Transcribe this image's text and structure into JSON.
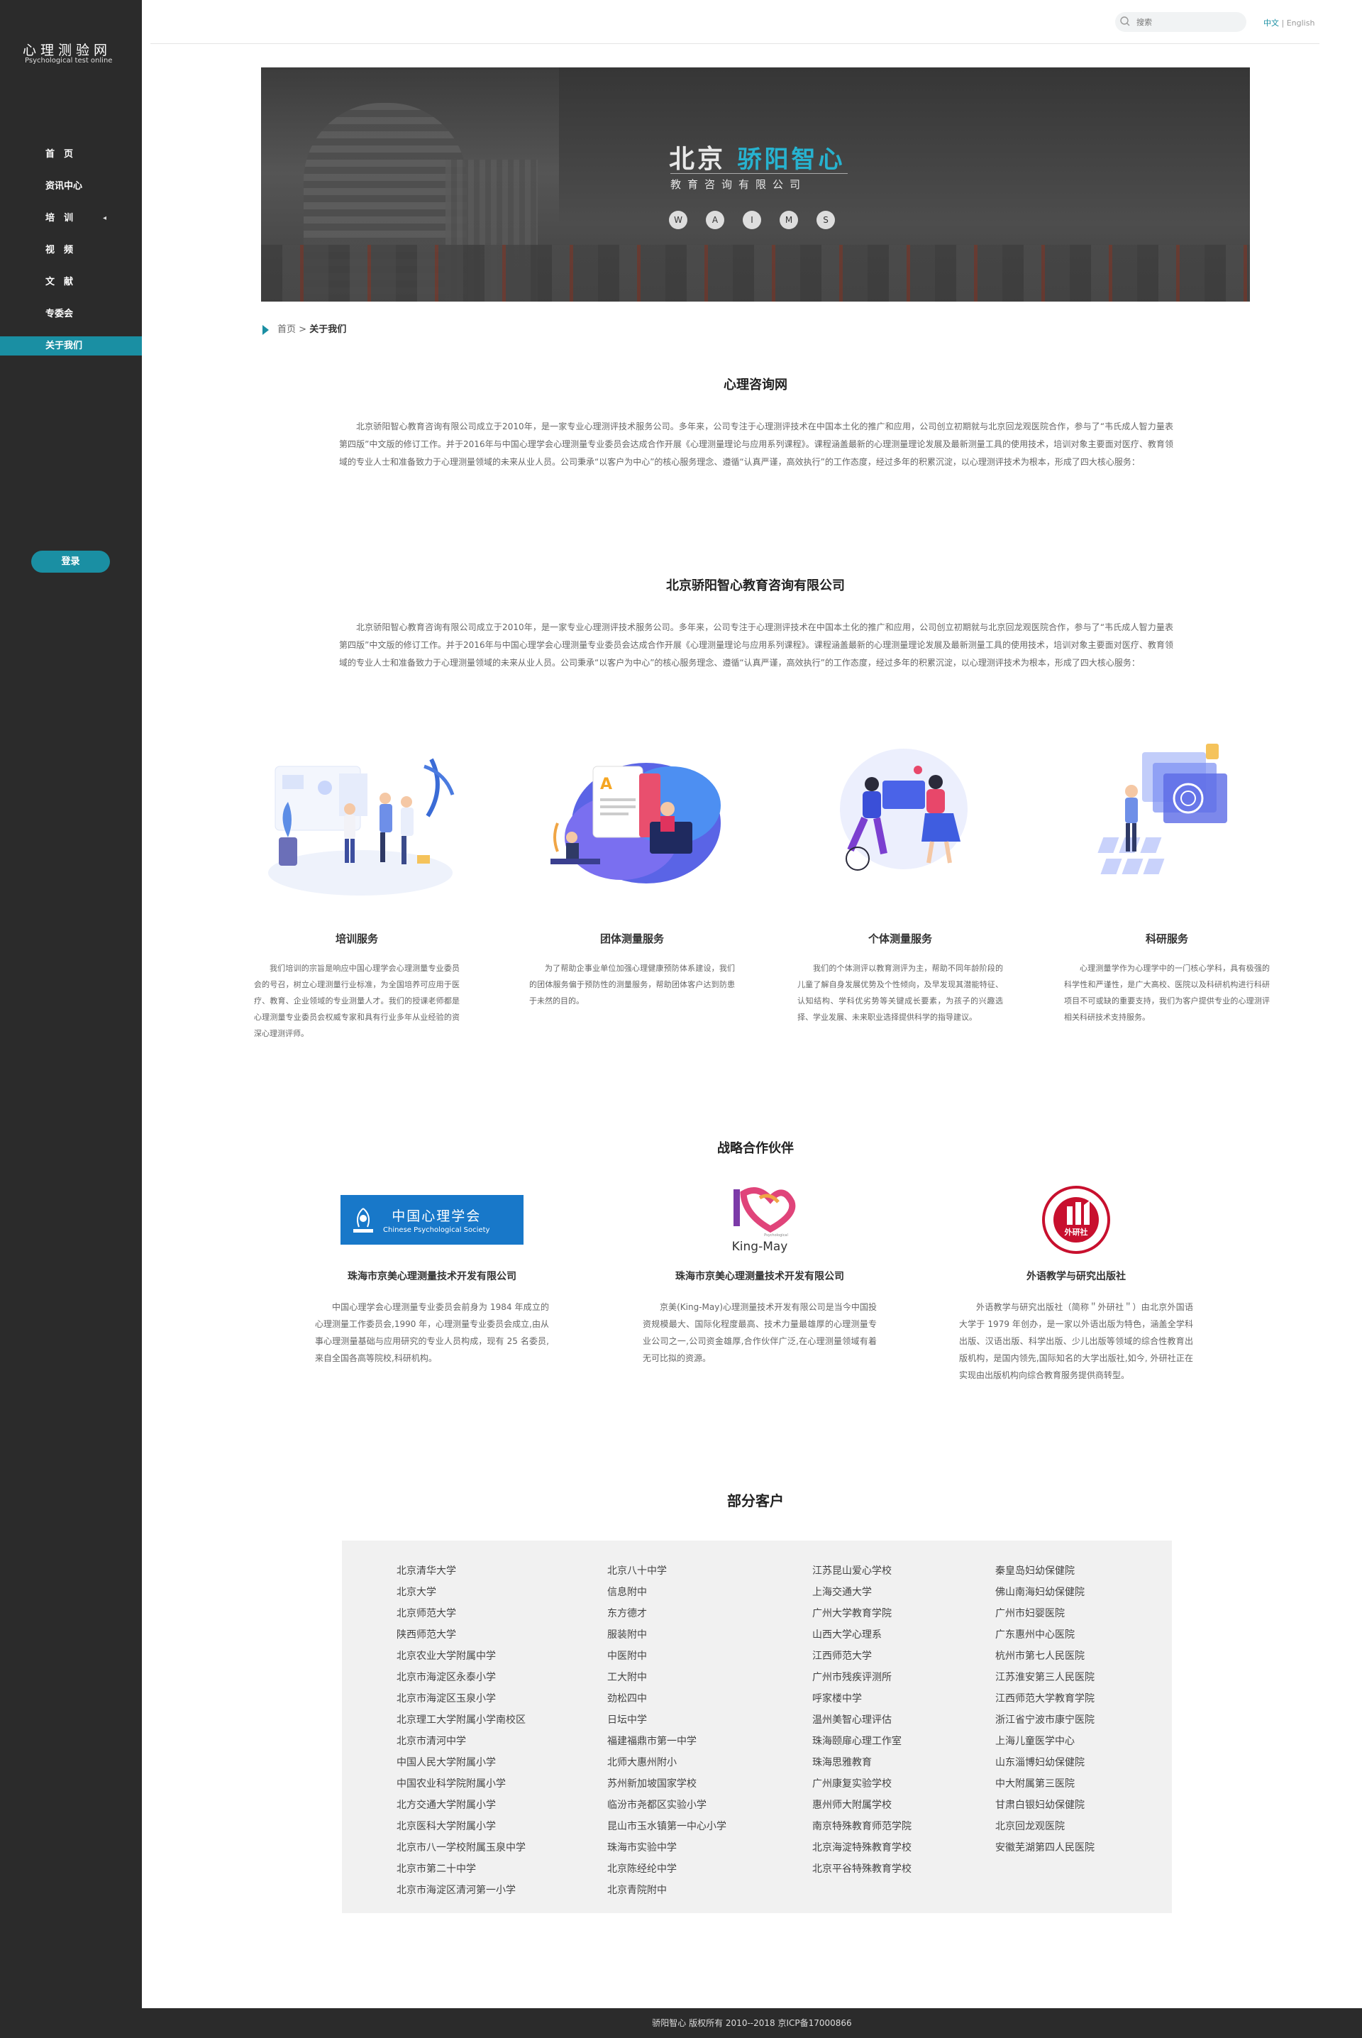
{
  "sidebar": {
    "logo_cn": "心理测验网",
    "logo_en": "Psychological test online",
    "nav": [
      {
        "label": "首　页"
      },
      {
        "label": "资讯中心"
      },
      {
        "label": "培　训",
        "arrow": "◂"
      },
      {
        "label": "视　频"
      },
      {
        "label": "文　献"
      },
      {
        "label": "专委会"
      },
      {
        "label": "关于我们"
      }
    ],
    "login": "登录"
  },
  "header": {
    "search_placeholder": "搜索",
    "lang_cn": "中文",
    "lang_sep": " | ",
    "lang_en": "English"
  },
  "banner": {
    "title_main": "北京",
    "title_accent": "骄阳智心",
    "subtitle": "教育咨询有限公司",
    "letters": [
      "W",
      "A",
      "I",
      "M",
      "S"
    ]
  },
  "breadcrumb": {
    "home": "首页",
    "sep": " > ",
    "current": "关于我们"
  },
  "section1": {
    "title": "心理咨询网",
    "text": "北京骄阳智心教育咨询有限公司成立于2010年，是一家专业心理测评技术服务公司。多年来，公司专注于心理测评技术在中国本土化的推广和应用，公司创立初期就与北京回龙观医院合作，参与了“韦氏成人智力量表第四版”中文版的修订工作。并于2016年与中国心理学会心理测量专业委员会达成合作开展《心理测量理论与应用系列课程》。课程涵盖最新的心理测量理论发展及最新测量工具的使用技术，培训对象主要面对医疗、教育领域的专业人士和准备致力于心理测量领域的未来从业人员。公司秉承“以客户为中心”的核心服务理念、遵循“认真严谨，高效执行”的工作态度，经过多年的积累沉淀，以心理测评技术为根本，形成了四大核心服务："
  },
  "section2": {
    "title": "北京骄阳智心教育咨询有限公司",
    "text": "北京骄阳智心教育咨询有限公司成立于2010年，是一家专业心理测评技术服务公司。多年来，公司专注于心理测评技术在中国本土化的推广和应用，公司创立初期就与北京回龙观医院合作，参与了“韦氏成人智力量表第四版”中文版的修订工作。并于2016年与中国心理学会心理测量专业委员会达成合作开展《心理测量理论与应用系列课程》。课程涵盖最新的心理测量理论发展及最新测量工具的使用技术，培训对象主要面对医疗、教育领域的专业人士和准备致力于心理测量领域的未来从业人员。公司秉承“以客户为中心”的核心服务理念、遵循“认真严谨，高效执行”的工作态度，经过多年的积累沉淀，以心理测评技术为根本，形成了四大核心服务："
  },
  "services": [
    {
      "title": "培训服务",
      "desc": "我们培训的宗旨是响应中国心理学会心理测量专业委员会的号召，树立心理测量行业标准，为全国培养可应用于医疗、教育、企业领域的专业测量人才。我们的授课老师都是心理测量专业委员会权威专家和具有行业多年从业经验的资深心理测评师。"
    },
    {
      "title": "团体测量服务",
      "desc": "为了帮助企事业单位加强心理健康预防体系建设，我们的团体服务偏于预防性的测量服务，帮助团体客户达到防患于未然的目的。"
    },
    {
      "title": "个体测量服务",
      "desc": "我们的个体测评以教育测评为主，帮助不同年龄阶段的儿童了解自身发展优势及个性倾向，及早发现其潜能特征、认知结构、学科优劣势等关键成长要素，为孩子的兴趣选择、学业发展、未来职业选择提供科学的指导建议。"
    },
    {
      "title": "科研服务",
      "desc": "心理测量学作为心理学中的一门核心学科，具有极强的科学性和严谨性，是广大高校、医院以及科研机构进行科研项目不可或缺的重要支持，我们为客户提供专业的心理测评相关科研技术支持服务。"
    }
  ],
  "partners_title": "战略合作伙伴",
  "partners": [
    {
      "logo_cn": "中国心理学会",
      "logo_en": "Chinese Psychological Society",
      "logo_seal": "中国心理学会",
      "name": "珠海市京美心理测量技术开发有限公司",
      "desc": "中国心理学会心理测量专业委员会前身为 1984 年成立的心理测量工作委员会,1990 年，心理测量专业委员会成立,由从事心理测量基础与应用研究的专业人员构成，现有 25 名委员,来自全国各高等院校,科研机构。"
    },
    {
      "logo_text": "King-May",
      "logo_small": "Psychological",
      "name": "珠海市京美心理测量技术开发有限公司",
      "desc": "京美(King-May)心理测量技术开发有限公司是当今中国投资规模最大、国际化程度最高、技术力量最雄厚的心理测量专业公司之一,公司资金雄厚,合作伙伴广泛,在心理测量领域有着无可比拟的资源。"
    },
    {
      "logo_text": "外研社",
      "logo_ring": "FOREIGN LANGUAGE TEACHING AND RESEARCH PRESS",
      "name": "外语教学与研究出版社",
      "desc": "外语教学与研究出版社（简称＂外研社＂）由北京外国语大学于 1979 年创办，是一家以外语出版为特色，涵盖全学科出版、汉语出版、科学出版、少儿出版等领域的综合性教育出版机构，是国内领先,国际知名的大学出版社,如今, 外研社正在实现由出版机构向综合教育服务提供商转型。"
    }
  ],
  "clients_title": "部分客户",
  "clients": [
    [
      "北京清华大学",
      "北京大学",
      "北京师范大学",
      "陕西师范大学",
      "北京农业大学附属中学",
      "北京市海淀区永泰小学",
      "北京市海淀区玉泉小学",
      "北京理工大学附属小学南校区",
      "北京市清河中学",
      "中国人民大学附属小学",
      "中国农业科学院附属小学",
      "北方交通大学附属小学",
      "北京医科大学附属小学",
      "北京市八一学校附属玉泉中学",
      "北京市第二十中学",
      "北京市海淀区清河第一小学"
    ],
    [
      "北京八十中学",
      "信息附中",
      "东方德才",
      "服装附中",
      "中医附中",
      "工大附中",
      "劲松四中",
      "日坛中学",
      "福建福鼎市第一中学",
      "北师大惠州附小",
      "苏州新加坡国家学校",
      "临汾市尧都区实验小学",
      "昆山市玉水镇第一中心小学",
      "珠海市实验中学",
      "北京陈经纶中学",
      "北京青院附中"
    ],
    [
      "江苏昆山爱心学校",
      "上海交通大学",
      "广州大学教育学院",
      "山西大学心理系",
      "江西师范大学",
      "广州市残疾评测所",
      "呼家楼中学",
      "温州美智心理评估",
      "珠海颐扉心理工作室",
      "珠海思雅教育",
      "广州康复实验学校",
      "惠州师大附属学校",
      "南京特殊教育师范学院",
      "北京海淀特殊教育学校",
      "北京平谷特殊教育学校"
    ],
    [
      "秦皇岛妇幼保健院",
      "佛山南海妇幼保健院",
      "广州市妇婴医院",
      "广东惠州中心医院",
      "杭州市第七人民医院",
      "江苏淮安第三人民医院",
      "江西师范大学教育学院",
      "浙江省宁波市康宁医院",
      "上海儿童医学中心",
      "山东淄博妇幼保健院",
      "中大附属第三医院",
      "甘肃白银妇幼保健院",
      "北京回龙观医院",
      "安徽芜湖第四人民医院"
    ]
  ],
  "footer": "骄阳智心 版权所有 2010--2018 京ICP备17000866"
}
